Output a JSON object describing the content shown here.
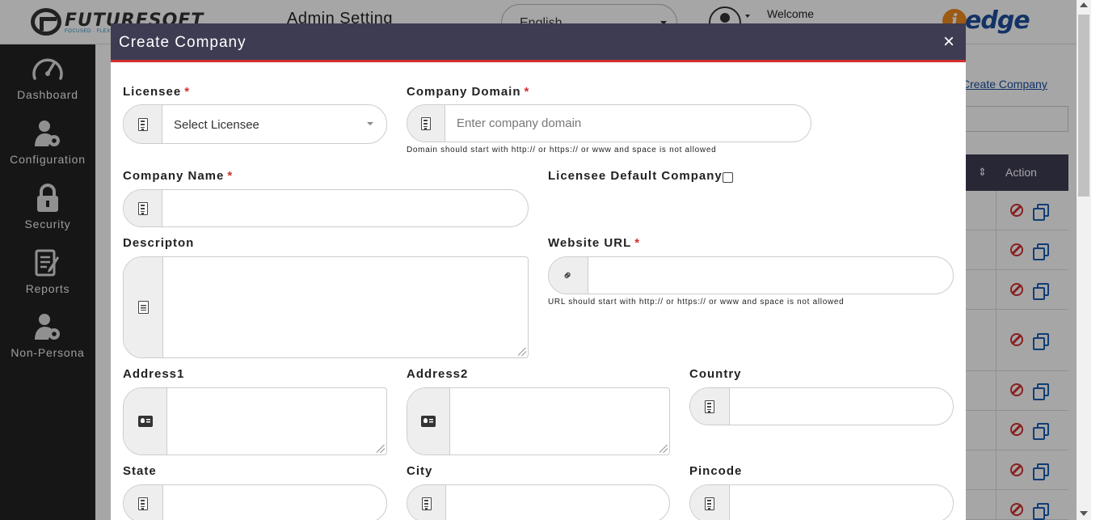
{
  "header": {
    "logo_name": "FUTURESOFT",
    "logo_tagline": "FOCUSED · FLEXIBLE",
    "page_title": "Admin Setting",
    "language": "English",
    "welcome": "Welcome",
    "brand_i": "i",
    "brand_name": "edge"
  },
  "sidebar": {
    "items": [
      {
        "label": "Dashboard",
        "icon": "speedometer-icon"
      },
      {
        "label": "Configuration",
        "icon": "user-gear-icon"
      },
      {
        "label": "Security",
        "icon": "lock-icon"
      },
      {
        "label": "Reports",
        "icon": "report-icon"
      },
      {
        "label": "Non-Persona",
        "icon": "user-gear-icon"
      }
    ]
  },
  "background": {
    "create_link": "Create Company",
    "action_header": "Action",
    "sort_icon": "⇕"
  },
  "modal": {
    "title": "Create Company",
    "close": "×",
    "fields": {
      "licensee": {
        "label": "Licensee",
        "placeholder": "Select Licensee",
        "required": "*"
      },
      "company_domain": {
        "label": "Company Domain",
        "placeholder": "Enter company domain",
        "required": "*",
        "hint": "Domain should start with http:// or https:// or www and space is not allowed"
      },
      "company_name": {
        "label": "Company Name",
        "required": "*",
        "value": ""
      },
      "licensee_default": {
        "label": "Licensee Default Company",
        "checked": false
      },
      "description": {
        "label": "Descripton",
        "value": ""
      },
      "website_url": {
        "label": "Website URL",
        "required": "*",
        "value": "",
        "hint": "URL should start with http:// or https:// or www and space is not allowed"
      },
      "address1": {
        "label": "Address1",
        "value": ""
      },
      "address2": {
        "label": "Address2",
        "value": ""
      },
      "country": {
        "label": "Country",
        "value": ""
      },
      "state": {
        "label": "State",
        "value": ""
      },
      "city": {
        "label": "City",
        "value": ""
      },
      "pincode": {
        "label": "Pincode",
        "value": ""
      }
    }
  },
  "colors": {
    "header_dark": "#3e3c52",
    "accent_red": "#d32f2f",
    "sidebar_bg": "#222222",
    "link_blue": "#1a4fa0"
  }
}
